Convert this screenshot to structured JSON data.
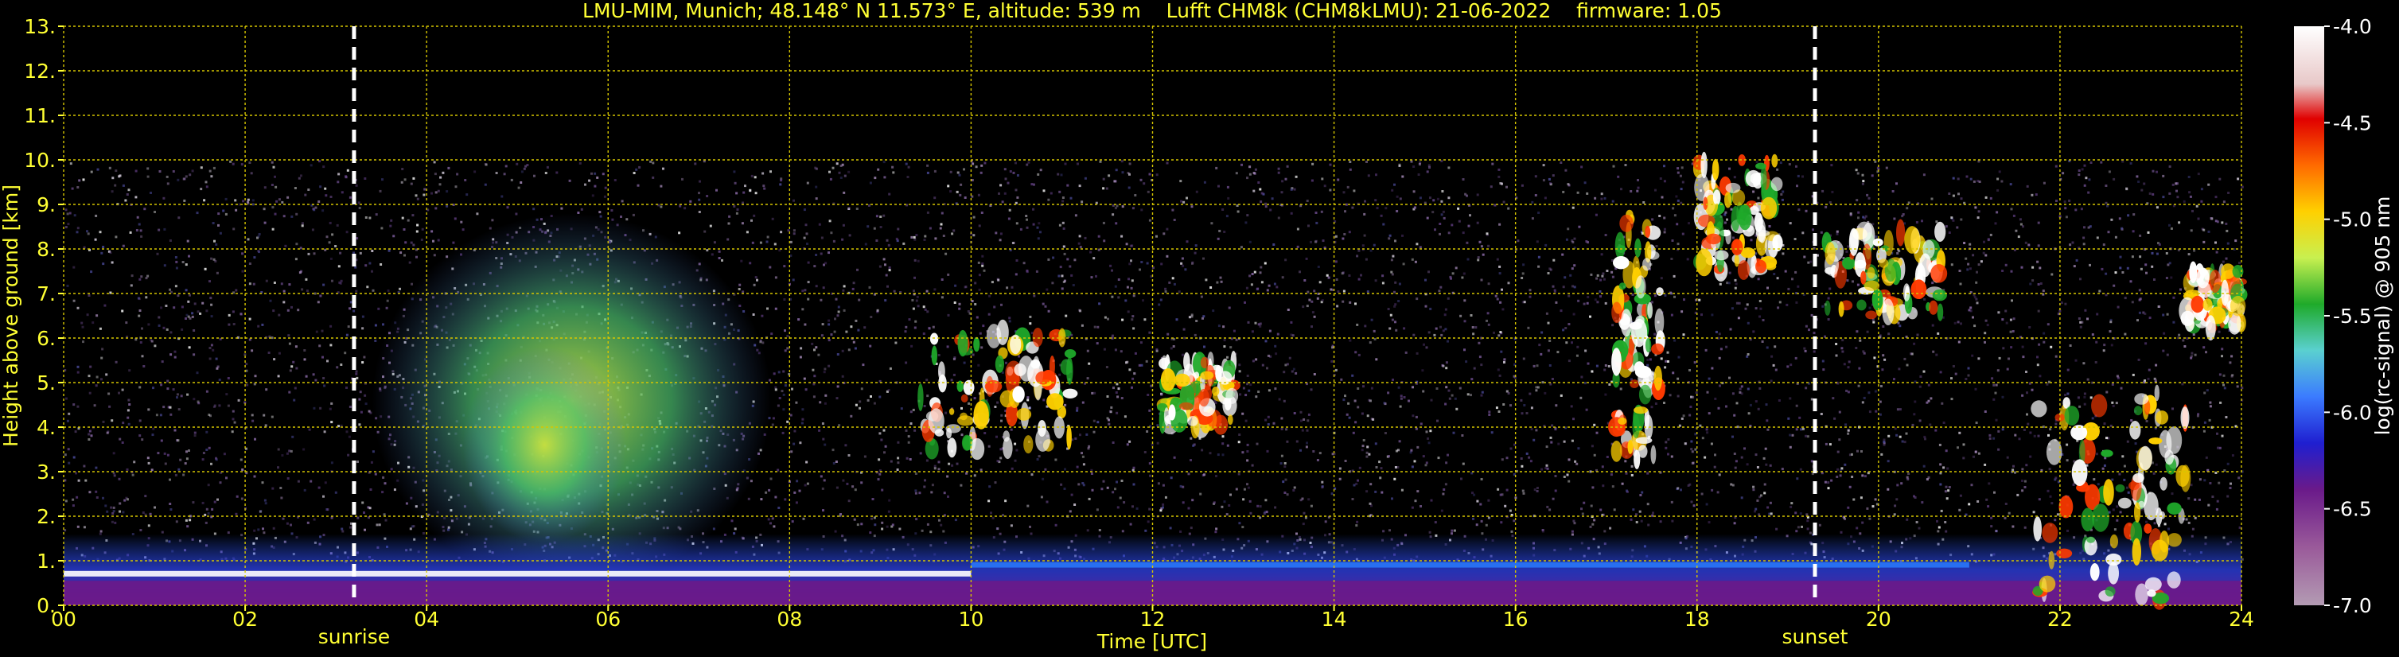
{
  "chart_data": {
    "type": "heatmap",
    "title": "LMU-MIM, Munich; 48.148° N 11.573° E, altitude: 539 m    Lufft CHM8k (CHM8kLMU): 21-06-2022    firmware: 1.05",
    "xlabel": "Time [UTC]",
    "ylabel": "Height above ground [km]",
    "xlim": [
      0,
      24
    ],
    "ylim": [
      0,
      13
    ],
    "x_ticks": [
      "00",
      "02",
      "04",
      "06",
      "08",
      "10",
      "12",
      "14",
      "16",
      "18",
      "20",
      "22",
      "24"
    ],
    "y_ticks": [
      "0.",
      "1.",
      "2.",
      "3.",
      "4.",
      "5.",
      "6.",
      "7.",
      "8.",
      "9.",
      "10.",
      "11.",
      "12.",
      "13."
    ],
    "grid": true,
    "data_max_height": 10,
    "colorbar": {
      "label": "log(rc-signal) @ 905 nm",
      "range": [
        -7.0,
        -4.0
      ],
      "ticks": [
        "-4.0",
        "-4.5",
        "-5.0",
        "-5.5",
        "-6.0",
        "-6.5",
        "-7.0"
      ]
    },
    "annotations": [
      {
        "label": "sunrise",
        "x": 3.2
      },
      {
        "label": "sunset",
        "x": 19.3
      }
    ],
    "features": {
      "boundary_layer_top_km": 0.7,
      "clouds": [
        {
          "t0": 9.4,
          "t1": 11.1,
          "h0": 3.5,
          "h1": 6.3
        },
        {
          "t0": 12.1,
          "t1": 12.9,
          "h0": 4.0,
          "h1": 5.5
        },
        {
          "t0": 17.1,
          "t1": 17.6,
          "h0": 3.0,
          "h1": 8.8
        },
        {
          "t0": 18.0,
          "t1": 18.9,
          "h0": 7.5,
          "h1": 10.0
        },
        {
          "t0": 19.4,
          "t1": 20.7,
          "h0": 6.5,
          "h1": 8.4
        },
        {
          "t0": 21.7,
          "t1": 23.5,
          "h0": 0.1,
          "h1": 4.8
        },
        {
          "t0": 23.4,
          "t1": 24.0,
          "h0": 6.2,
          "h1": 7.5
        }
      ]
    }
  }
}
